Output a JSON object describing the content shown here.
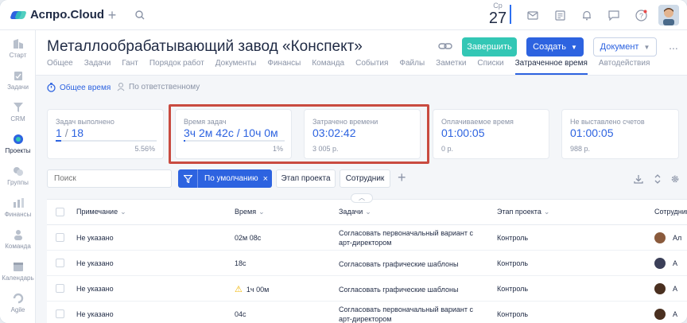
{
  "app": {
    "name": "Аспро.Cloud"
  },
  "topbar": {
    "date_dow": "Ср",
    "date_day": "27",
    "icons": [
      "plus-icon",
      "search-icon",
      "mail-icon",
      "notes-icon",
      "bell-icon",
      "chat-icon",
      "help-icon",
      "user-avatar"
    ]
  },
  "sidebar": {
    "items": [
      {
        "label": "Старт",
        "icon": "start-icon"
      },
      {
        "label": "Задачи",
        "icon": "tasks-icon"
      },
      {
        "label": "CRM",
        "icon": "crm-icon"
      },
      {
        "label": "Проекты",
        "icon": "projects-icon",
        "active": true
      },
      {
        "label": "Группы",
        "icon": "groups-icon"
      },
      {
        "label": "Финансы",
        "icon": "finance-icon"
      },
      {
        "label": "Команда",
        "icon": "team-icon"
      },
      {
        "label": "Календарь",
        "icon": "calendar-icon"
      },
      {
        "label": "Agile",
        "icon": "agile-icon"
      }
    ]
  },
  "header": {
    "title": "Металлообрабатывающий завод «Конспект»",
    "finish_label": "Завершить",
    "create_label": "Создать",
    "document_label": "Документ",
    "more_label": "..."
  },
  "tabs": [
    "Общее",
    "Задачи",
    "Гант",
    "Порядок работ",
    "Документы",
    "Финансы",
    "Команда",
    "События",
    "Файлы",
    "Заметки",
    "Списки",
    "Затраченное время",
    "Автодействия"
  ],
  "active_tab": "Затраченное время",
  "subbar": {
    "total_label": "Общее время",
    "by_resp_label": "По ответственному"
  },
  "cards": {
    "tasks_done": {
      "label": "Задач выполнено",
      "value": "1",
      "total": "18",
      "percent": "5.56%",
      "progress": 0.0556
    },
    "task_time": {
      "label": "Время задач",
      "value": "3ч 2м 42с / 10ч 0м",
      "percent": "1%",
      "progress": 0.01
    },
    "spent_time": {
      "label": "Затрачено времени",
      "value": "03:02:42",
      "sub": "3 005 р."
    },
    "billable": {
      "label": "Оплачиваемое время",
      "value": "01:00:05",
      "sub": "0 р."
    },
    "not_billed": {
      "label": "Не выставлено счетов",
      "value": "01:00:05",
      "sub": "988 р."
    }
  },
  "filters": {
    "search_placeholder": "Поиск",
    "preset_label": "По умолчанию",
    "preset_clear": "×",
    "chip_stage": "Этап проекта",
    "chip_employee": "Сотрудник",
    "add": "+"
  },
  "table": {
    "columns": [
      "Примечание",
      "Время",
      "Задачи",
      "Этап проекта",
      "Сотрудник"
    ],
    "rows": [
      {
        "note": "Не указано",
        "time": "02м 08с",
        "task": "Согласовать первоначальный вариант с арт-директором",
        "stage": "Контроль",
        "employee": "Ал",
        "warn": false
      },
      {
        "note": "Не указано",
        "time": "18с",
        "task": "Согласовать графические шаблоны",
        "stage": "Контроль",
        "employee": "А",
        "warn": false
      },
      {
        "note": "Не указано",
        "time": "1ч 00м",
        "task": "Согласовать графические шаблоны",
        "stage": "Контроль",
        "employee": "А",
        "warn": true
      },
      {
        "note": "Не указано",
        "time": "04с",
        "task": "Согласовать первоначальный вариант с арт-директором",
        "stage": "Контроль",
        "employee": "А",
        "warn": false
      }
    ]
  },
  "colors": {
    "accent": "#2d63e0",
    "teal": "#33c7b5",
    "highlight": "#c94b40",
    "warn": "#f0b400"
  }
}
